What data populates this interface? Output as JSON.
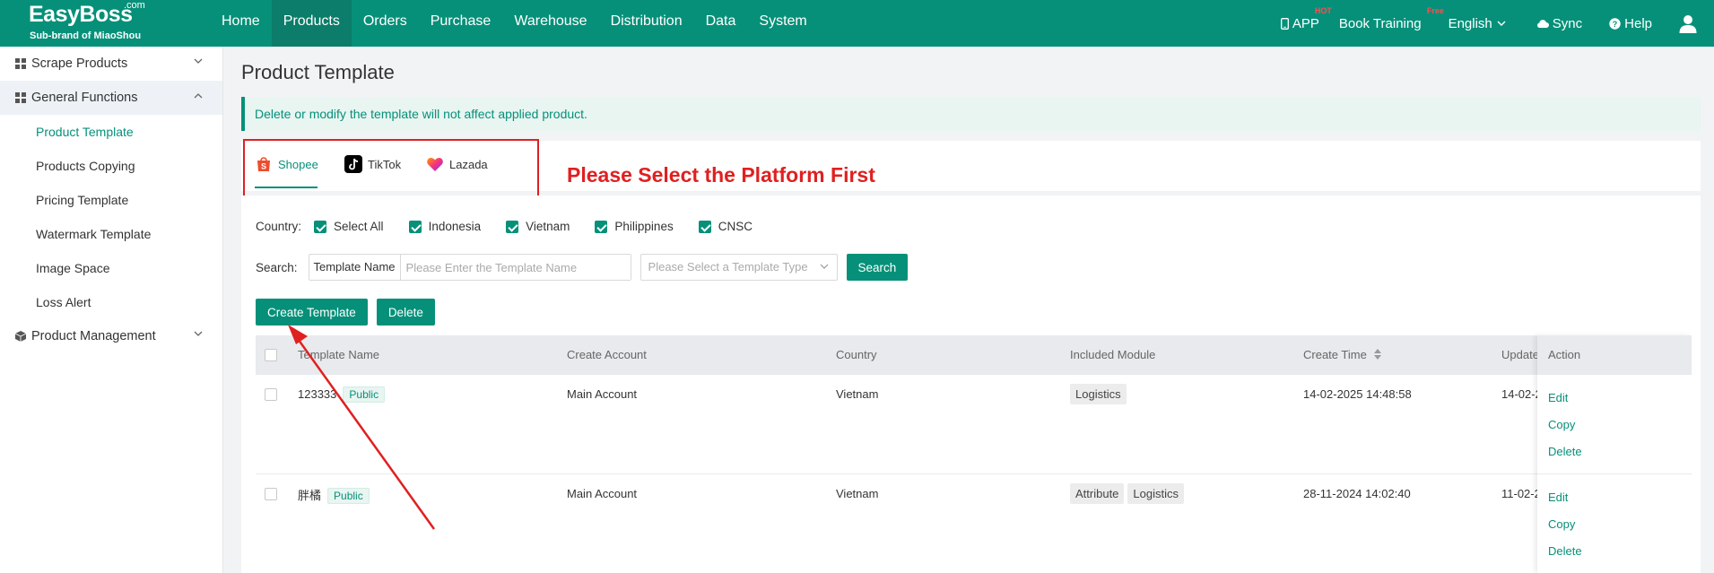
{
  "topbar": {
    "logo_brand": "EasyBoss",
    "logo_com": ".com",
    "logo_sub": "Sub-brand of MiaoShou",
    "nav": [
      "Home",
      "Products",
      "Orders",
      "Purchase",
      "Warehouse",
      "Distribution",
      "Data",
      "System"
    ],
    "active_nav": "Products",
    "app_label": "APP",
    "app_badge": "HOT",
    "training_label": "Book Training",
    "training_badge": "Free",
    "language": "English",
    "sync": "Sync",
    "help": "Help",
    "icons": [
      "phone-icon",
      "chevron-down-icon",
      "cloud-icon",
      "help-icon",
      "user-icon"
    ]
  },
  "sidebar": {
    "groups": [
      {
        "label": "Scrape Products",
        "icon": "grid-icon",
        "expanded": false
      },
      {
        "label": "General Functions",
        "icon": "grid-icon",
        "expanded": true,
        "items": [
          "Product Template",
          "Products Copying",
          "Pricing Template",
          "Watermark Template",
          "Image Space",
          "Loss Alert"
        ]
      },
      {
        "label": "Product Management",
        "icon": "box-icon",
        "expanded": false
      }
    ],
    "active_item": "Product Template"
  },
  "main": {
    "title": "Product Template",
    "notice": "Delete or modify the template will not affect applied product.",
    "platforms": [
      "Shopee",
      "TikTok",
      "Lazada"
    ],
    "active_platform": "Shopee",
    "annotation": "Please Select the Platform First",
    "country_label": "Country:",
    "countries": [
      {
        "label": "Select All",
        "checked": true
      },
      {
        "label": "Indonesia",
        "checked": true
      },
      {
        "label": "Vietnam",
        "checked": true
      },
      {
        "label": "Philippines",
        "checked": true
      },
      {
        "label": "CNSC",
        "checked": true
      }
    ],
    "search_label": "Search:",
    "search_prefix": "Template Name",
    "search_placeholder": "Please Enter the Template Name",
    "type_placeholder": "Please Select a Template Type",
    "search_button": "Search",
    "create_button": "Create Template",
    "delete_button": "Delete",
    "table": {
      "headers": [
        "Template Name",
        "Create Account",
        "Country",
        "Included Module",
        "Create Time",
        "Update",
        "Action"
      ],
      "rows": [
        {
          "name": "123333",
          "tag": "Public",
          "account": "Main Account",
          "country": "Vietnam",
          "modules": [
            "Logistics"
          ],
          "create_time": "14-02-2025 14:48:58",
          "update_time": "14-02-2"
        },
        {
          "name": "胖橘",
          "tag": "Public",
          "account": "Main Account",
          "country": "Vietnam",
          "modules": [
            "Attribute",
            "Logistics"
          ],
          "create_time": "28-11-2024 14:02:40",
          "update_time": "11-02-2"
        }
      ],
      "actions": [
        "Edit",
        "Copy",
        "Delete"
      ]
    }
  },
  "colors": {
    "brand": "#069079",
    "annotation": "#e02020"
  }
}
